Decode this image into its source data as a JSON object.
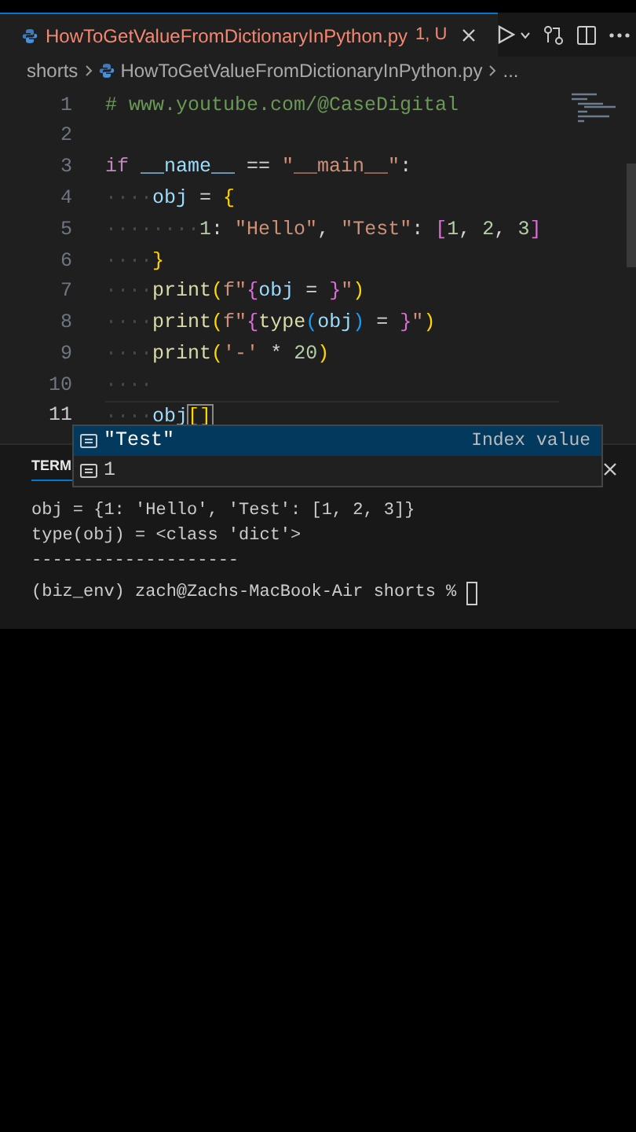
{
  "tab": {
    "filename": "HowToGetValueFromDictionaryInPython.py",
    "problems": "1, U",
    "selected": true
  },
  "breadcrumb": {
    "folder": "shorts",
    "file": "HowToGetValueFromDictionaryInPython.py",
    "more": "..."
  },
  "editor": {
    "lines": [
      {
        "number": "1",
        "current": false,
        "tokens": [
          {
            "kind": "comment",
            "text": "# www.youtube.com/@CaseDigital"
          }
        ]
      },
      {
        "number": "2",
        "current": false
      },
      {
        "number": "3",
        "current": false,
        "tokens": [
          {
            "kind": "keyword",
            "text": "if"
          },
          {
            "kind": "variable",
            "text": " __name__"
          },
          {
            "kind": "plain",
            "text": " == "
          },
          {
            "kind": "string",
            "text": "\"__main__\""
          },
          {
            "kind": "plain",
            "text": ":"
          }
        ]
      },
      {
        "number": "4",
        "current": false,
        "tokens": [
          {
            "kind": "whitespace",
            "text": "····"
          },
          {
            "kind": "variable",
            "text": "obj"
          },
          {
            "kind": "plain",
            "text": " = "
          },
          {
            "kind": "bracket1",
            "text": "{"
          }
        ]
      },
      {
        "number": "5",
        "current": false,
        "tokens": [
          {
            "kind": "whitespace",
            "text": "········"
          },
          {
            "kind": "number",
            "text": "1"
          },
          {
            "kind": "plain",
            "text": ": "
          },
          {
            "kind": "string",
            "text": "\"Hello\""
          },
          {
            "kind": "plain",
            "text": ", "
          },
          {
            "kind": "string",
            "text": "\"Test\""
          },
          {
            "kind": "plain",
            "text": ": "
          },
          {
            "kind": "bracket2",
            "text": "["
          },
          {
            "kind": "number",
            "text": "1"
          },
          {
            "kind": "plain",
            "text": ", "
          },
          {
            "kind": "number",
            "text": "2"
          },
          {
            "kind": "plain",
            "text": ", "
          },
          {
            "kind": "number",
            "text": "3"
          },
          {
            "kind": "bracket2",
            "text": "]"
          }
        ]
      },
      {
        "number": "6",
        "current": false,
        "tokens": [
          {
            "kind": "whitespace",
            "text": "····"
          },
          {
            "kind": "bracket1",
            "text": "}"
          }
        ]
      },
      {
        "number": "7",
        "current": false,
        "tokens": [
          {
            "kind": "whitespace",
            "text": "····"
          },
          {
            "kind": "function",
            "text": "print"
          },
          {
            "kind": "bracket1",
            "text": "("
          },
          {
            "kind": "string",
            "text": "f\""
          },
          {
            "kind": "bracket2",
            "text": "{"
          },
          {
            "kind": "variable",
            "text": "obj"
          },
          {
            "kind": "plain",
            "text": " = "
          },
          {
            "kind": "bracket2",
            "text": "}"
          },
          {
            "kind": "string",
            "text": "\""
          },
          {
            "kind": "bracket1",
            "text": ")"
          }
        ]
      },
      {
        "number": "8",
        "current": false,
        "tokens": [
          {
            "kind": "whitespace",
            "text": "····"
          },
          {
            "kind": "function",
            "text": "print"
          },
          {
            "kind": "bracket1",
            "text": "("
          },
          {
            "kind": "string",
            "text": "f\""
          },
          {
            "kind": "bracket2",
            "text": "{"
          },
          {
            "kind": "function",
            "text": "type"
          },
          {
            "kind": "bracket3",
            "text": "("
          },
          {
            "kind": "variable",
            "text": "obj"
          },
          {
            "kind": "bracket3",
            "text": ")"
          },
          {
            "kind": "plain",
            "text": " = "
          },
          {
            "kind": "bracket2",
            "text": "}"
          },
          {
            "kind": "string",
            "text": "\""
          },
          {
            "kind": "bracket1",
            "text": ")"
          }
        ]
      },
      {
        "number": "9",
        "current": false,
        "tokens": [
          {
            "kind": "whitespace",
            "text": "····"
          },
          {
            "kind": "function",
            "text": "print"
          },
          {
            "kind": "bracket1",
            "text": "("
          },
          {
            "kind": "string",
            "text": "'-'"
          },
          {
            "kind": "plain",
            "text": " * "
          },
          {
            "kind": "number",
            "text": "20"
          },
          {
            "kind": "bracket1",
            "text": ")"
          }
        ]
      },
      {
        "number": "10",
        "current": false,
        "tokens": [
          {
            "kind": "whitespace",
            "text": "····"
          }
        ]
      },
      {
        "number": "11",
        "current": true,
        "tokens": [
          {
            "kind": "whitespace",
            "text": "····"
          },
          {
            "kind": "variable",
            "text": "obj"
          },
          {
            "kind": "matched",
            "text": "[]"
          }
        ]
      }
    ]
  },
  "suggestions": [
    {
      "label": "\"Test\"",
      "detail": "Index value",
      "selected": true
    },
    {
      "label": "1",
      "selected": false
    }
  ],
  "panel": {
    "tab": "TERM"
  },
  "terminal": {
    "lines": [
      "obj = {1: 'Hello', 'Test': [1, 2, 3]}",
      "type(obj) = <class 'dict'>",
      "--------------------"
    ],
    "prompt": "(biz_env) zach@Zachs-MacBook-Air shorts %"
  }
}
